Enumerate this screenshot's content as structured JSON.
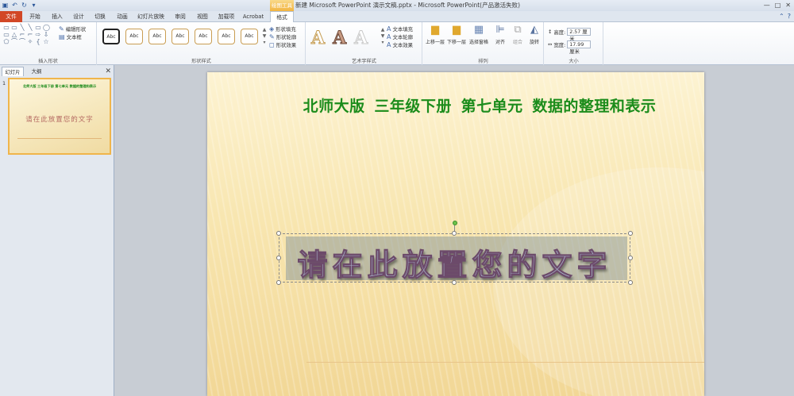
{
  "title_bar": {
    "qat_icons": [
      "save-icon",
      "undo-icon",
      "redo-icon",
      "customize-icon"
    ],
    "context_tag": "绘图工具",
    "document_title": "新建 Microsoft PowerPoint 演示文稿.pptx  -  Microsoft PowerPoint(产品激活失败)",
    "window_buttons": [
      "—",
      "□",
      "✕"
    ]
  },
  "tabs": [
    {
      "label": "文件"
    },
    {
      "label": "开始"
    },
    {
      "label": "插入"
    },
    {
      "label": "设计"
    },
    {
      "label": "切换"
    },
    {
      "label": "动画"
    },
    {
      "label": "幻灯片放映"
    },
    {
      "label": "审阅"
    },
    {
      "label": "视图"
    },
    {
      "label": "加载项"
    },
    {
      "label": "Acrobat"
    },
    {
      "label": "格式"
    }
  ],
  "ribbon": {
    "insert_shapes": {
      "label": "插入形状",
      "shapes": [
        "▭",
        "▭",
        "╲",
        "╲",
        "▭",
        "◯",
        "▭",
        "△",
        "⌐",
        "⌐",
        "⇨",
        "⇩",
        "⬠",
        "⌒",
        "⌒",
        "✧",
        "{",
        "☆"
      ],
      "edit_shape": "编辑形状",
      "text_box": "文本框"
    },
    "shape_styles": {
      "label": "形状样式",
      "swatches": [
        "Abc",
        "Abc",
        "Abc",
        "Abc",
        "Abc",
        "Abc",
        "Abc"
      ],
      "fill": "形状填充",
      "outline": "形状轮廓",
      "effects": "形状效果"
    },
    "wordart_styles": {
      "label": "艺术字样式",
      "letters": [
        "A",
        "A",
        "A"
      ],
      "text_fill": "文本填充",
      "text_outline": "文本轮廓",
      "text_effects": "文本效果"
    },
    "arrange": {
      "label": "排列",
      "bring_forward": "上移一层",
      "send_backward": "下移一层",
      "selection_pane": "选择窗格",
      "align": "对齐",
      "group": "组合",
      "rotate": "旋转"
    },
    "size": {
      "label": "大小",
      "height_label": "高度:",
      "height_value": "2.57 厘米",
      "width_label": "宽度:",
      "width_value": "17.99 厘米"
    }
  },
  "panel": {
    "tab_slides": "幻灯片",
    "tab_outline": "大纲",
    "slide_number": "1",
    "thumb_title": "北师大版 三年级下册 第七单元 数据的整理和表示",
    "thumb_text": "请在此放置您的文字"
  },
  "slide": {
    "title": "北师大版  三年级下册  第七单元  数据的整理和表示",
    "wordart_text": "请在此放置您的文字"
  }
}
